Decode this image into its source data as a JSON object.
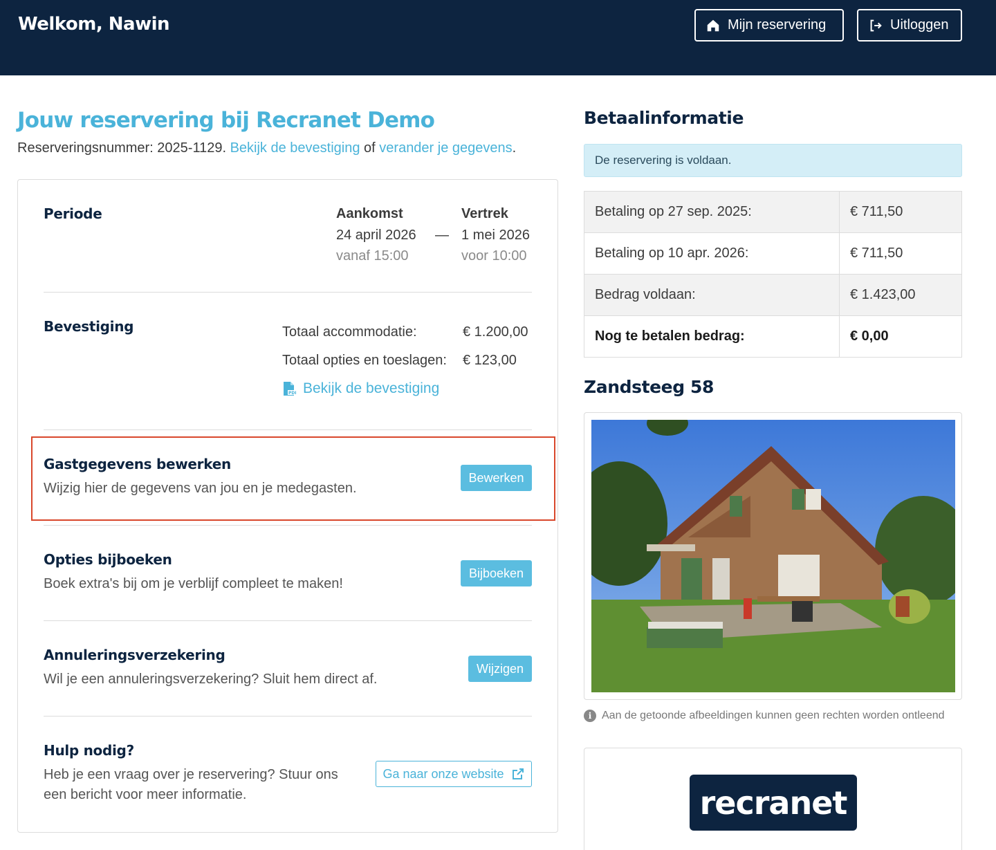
{
  "header": {
    "welcome": "Welkom, Nawin",
    "reservation_button": "Mijn reservering",
    "logout_button": "Uitloggen"
  },
  "reservation": {
    "title": "Jouw reservering bij Recranet Demo",
    "number_prefix": "Reserveringsnummer: 2025-1129.",
    "confirmation_link": "Bekijk de bevestiging",
    "or_text": "of",
    "edit_details_link": "verander je gegevens",
    "period_end": "."
  },
  "period": {
    "heading": "Periode",
    "arrival_label": "Aankomst",
    "arrival_date": "24 april 2026",
    "arrival_time": "vanaf 15:00",
    "separator": "—",
    "departure_label": "Vertrek",
    "departure_date": "1 mei 2026",
    "departure_time": "voor 10:00"
  },
  "confirmation": {
    "heading": "Bevestiging",
    "accommodation_label": "Totaal accommodatie:",
    "accommodation_value": "€ 1.200,00",
    "options_label": "Totaal opties en toeslagen:",
    "options_value": "€ 123,00",
    "pdf_link": "Bekijk de bevestiging"
  },
  "guest_details": {
    "heading": "Gastgegevens bewerken",
    "text": "Wijzig hier de gegevens van jou en je medegasten.",
    "button": "Bewerken"
  },
  "options": {
    "heading": "Opties bijboeken",
    "text": "Boek extra's bij om je verblijf compleet te maken!",
    "button": "Bijboeken"
  },
  "insurance": {
    "heading": "Annuleringsverzekering",
    "text": "Wil je een annuleringsverzekering? Sluit hem direct af.",
    "button": "Wijzigen"
  },
  "help": {
    "heading": "Hulp nodig?",
    "text_line1": "Heb je een vraag over je reservering? Stuur ons",
    "text_line2": "een bericht voor meer informatie.",
    "button": "Ga naar onze website"
  },
  "payment": {
    "title": "Betaalinformatie",
    "status": "De reservering is voldaan.",
    "rows": [
      {
        "label": "Betaling op 27 sep. 2025:",
        "value": "€ 711,50"
      },
      {
        "label": "Betaling op 10 apr. 2026:",
        "value": "€ 711,50"
      },
      {
        "label": "Bedrag voldaan:",
        "value": "€ 1.423,00"
      },
      {
        "label": "Nog te betalen bedrag:",
        "value": "€ 0,00"
      }
    ]
  },
  "property": {
    "title": "Zandsteeg 58",
    "disclaimer": "Aan de getoonde afbeeldingen kunnen geen rechten worden ontleend"
  },
  "logo": {
    "text": "recranet"
  },
  "colors": {
    "navy": "#0d2440",
    "accent": "#4ab3d9",
    "button": "#5bbde0",
    "highlight": "#d9472b",
    "alert_bg": "#d4eef7"
  }
}
